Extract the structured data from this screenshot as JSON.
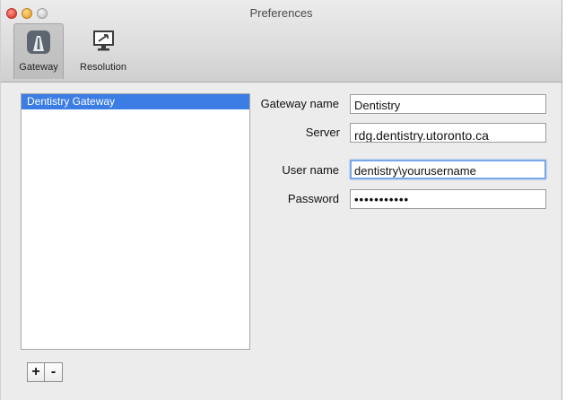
{
  "window": {
    "title": "Preferences"
  },
  "toolbar": {
    "items": [
      {
        "label": "Gateway",
        "icon": "gateway-icon",
        "selected": true
      },
      {
        "label": "Resolution",
        "icon": "display-icon",
        "selected": false
      }
    ]
  },
  "gateway_list": {
    "items": [
      {
        "label": "Dentistry Gateway",
        "selected": true
      }
    ],
    "add_label": "+",
    "remove_label": "-"
  },
  "form": {
    "gateway_name": {
      "label": "Gateway name",
      "value": "Dentistry"
    },
    "server": {
      "label": "Server",
      "value": "rdg.dentistry.utoronto.ca"
    },
    "user_name": {
      "label": "User name",
      "value": "dentistry\\yourusername"
    },
    "password": {
      "label": "Password",
      "value": "•••••••••••"
    }
  },
  "colors": {
    "selection": "#3b7de4",
    "focus_ring": "#7aa7e7"
  }
}
